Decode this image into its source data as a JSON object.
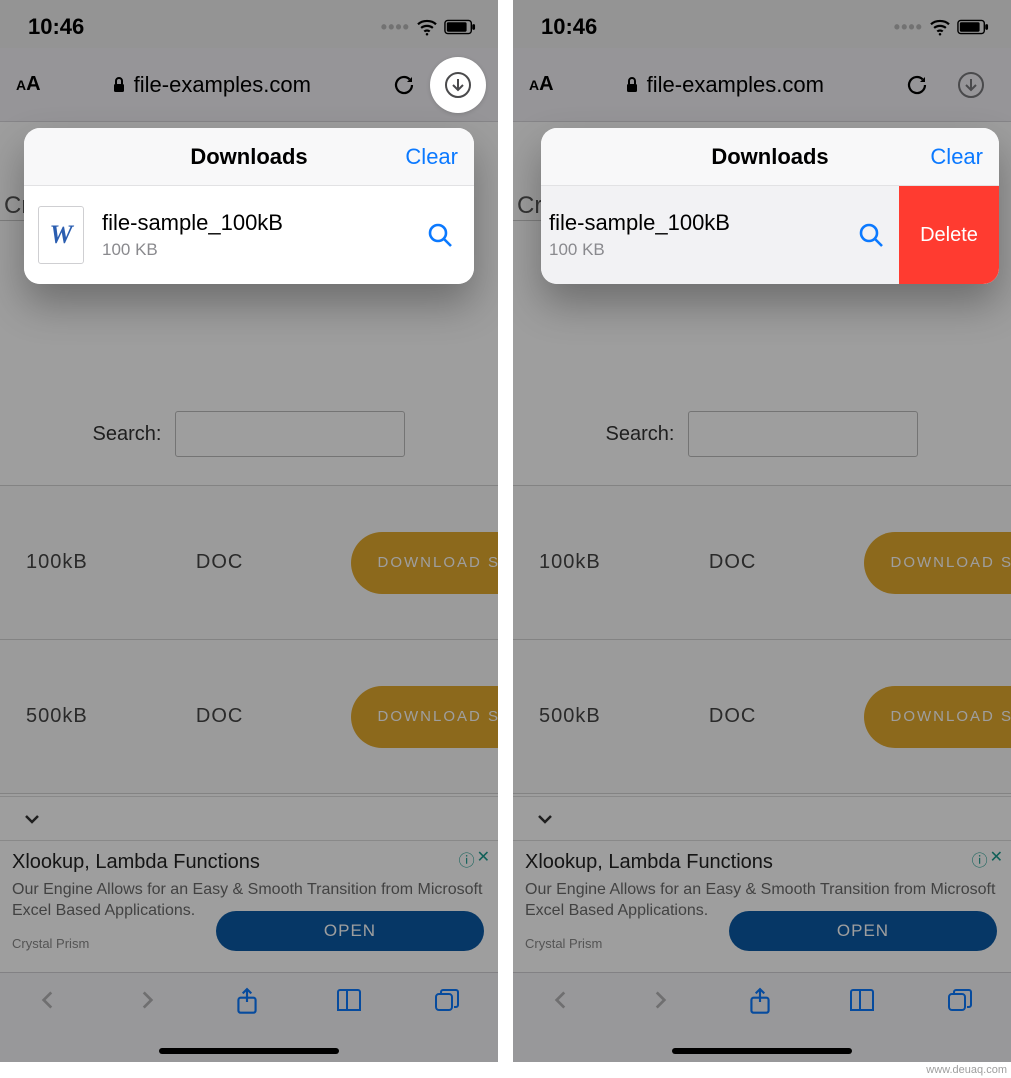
{
  "status": {
    "time": "10:46"
  },
  "addr": {
    "url": "file-examples.com"
  },
  "downloads": {
    "title": "Downloads",
    "clear": "Clear",
    "file": {
      "name": "file-sample_100kB",
      "size": "100 KB",
      "glyph": "W"
    },
    "delete": "Delete"
  },
  "page": {
    "cry": "Cry",
    "search_label": "Search:",
    "rows": [
      {
        "size": "100kB",
        "type": "DOC",
        "btn": "DOWNLOAD SA"
      },
      {
        "size": "500kB",
        "type": "DOC",
        "btn": "DOWNLOAD SA"
      }
    ]
  },
  "ad": {
    "title": "Xlookup, Lambda Functions",
    "body": "Our Engine Allows for an Easy & Smooth Transition from Microsoft Excel Based Applications.",
    "brand": "Crystal Prism",
    "cta": "OPEN"
  },
  "watermark": "www.deuaq.com"
}
